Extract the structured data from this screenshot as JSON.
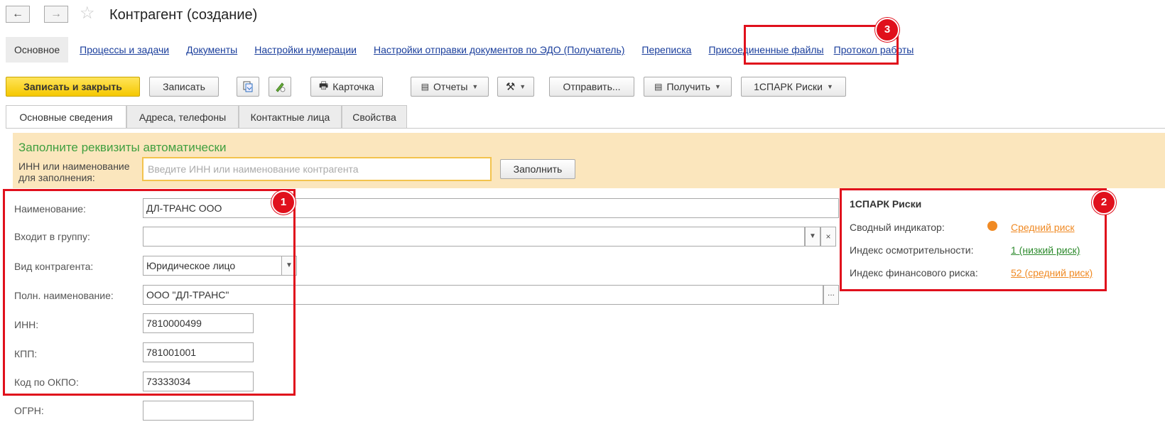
{
  "window": {
    "title": "Контрагент (создание)",
    "back_icon": "←",
    "forward_icon": "→",
    "star_icon": "☆"
  },
  "sections": [
    "Основное",
    "Процессы и задачи",
    "Документы",
    "Настройки нумерации",
    "Настройки отправки документов по ЭДО (Получатель)",
    "Переписка",
    "Присоединенные файлы",
    "Протокол работы"
  ],
  "toolbar": {
    "save_close": "Записать и закрыть",
    "save": "Записать",
    "card": "Карточка",
    "reports": "Отчеты",
    "send": "Отправить...",
    "receive": "Получить",
    "spark": "1СПАРК Риски"
  },
  "tabs": [
    "Основные сведения",
    "Адреса, телефоны",
    "Контактные лица",
    "Свойства"
  ],
  "autofill": {
    "title": "Заполните реквизиты автоматически",
    "label": "ИНН или наименование для заполнения:",
    "placeholder": "Введите ИНН или наименование контрагента",
    "button": "Заполнить"
  },
  "form": {
    "name_label": "Наименование:",
    "name_value": "ДЛ-ТРАНС ООО",
    "group_label": "Входит в группу:",
    "group_value": "",
    "kind_label": "Вид контрагента:",
    "kind_value": "Юридическое лицо",
    "fullname_label": "Полн. наименование:",
    "fullname_value": "ООО \"ДЛ-ТРАНС\"",
    "inn_label": "ИНН:",
    "inn_value": "7810000499",
    "kpp_label": "КПП:",
    "kpp_value": "781001001",
    "okpo_label": "Код по ОКПО:",
    "okpo_value": "73333034",
    "ogrn_label": "ОГРН:",
    "ogrn_value": ""
  },
  "risk": {
    "title": "1СПАРК Риски",
    "summary_label": "Сводный индикатор:",
    "summary_value": "Средний риск",
    "diligence_label": "Индекс осмотрительности:",
    "diligence_value": "1 (низкий риск)",
    "financial_label": "Индекс финансового риска:",
    "financial_value": "52 (средний риск)"
  },
  "badges": [
    "1",
    "2",
    "3"
  ],
  "colors": {
    "highlight": "#e0101c",
    "medium_risk": "#f08a24",
    "low_risk": "#2e8b2e",
    "link": "#1a3e9c",
    "primary_button": "#f5c800"
  }
}
